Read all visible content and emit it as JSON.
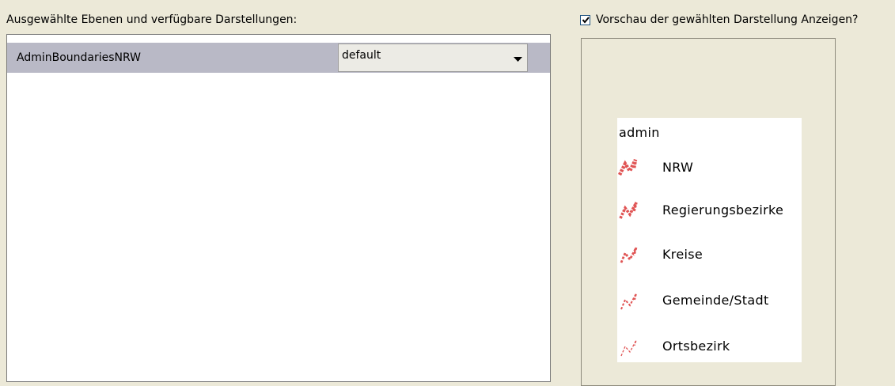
{
  "layers": {
    "header_label": "Ausgewählte Ebenen und verfügbare Darstellungen:",
    "rows": [
      {
        "name": "AdminBoundariesNRW",
        "style": "default"
      }
    ]
  },
  "preview": {
    "checkbox_label": "Vorschau der gewählten Darstellung Anzeigen?",
    "checked": true,
    "legend": {
      "title": "admin",
      "items": [
        {
          "label": "NRW",
          "icon": "boundary-line-icon",
          "color": "#e05454"
        },
        {
          "label": "Regierungsbezirke",
          "icon": "boundary-line-icon",
          "color": "#e05454"
        },
        {
          "label": "Kreise",
          "icon": "boundary-line-icon",
          "color": "#e05454"
        },
        {
          "label": "Gemeinde/Stadt",
          "icon": "boundary-line-icon",
          "color": "#e05454"
        },
        {
          "label": "Ortsbezirk",
          "icon": "boundary-line-icon",
          "color": "#e05454"
        }
      ]
    }
  }
}
